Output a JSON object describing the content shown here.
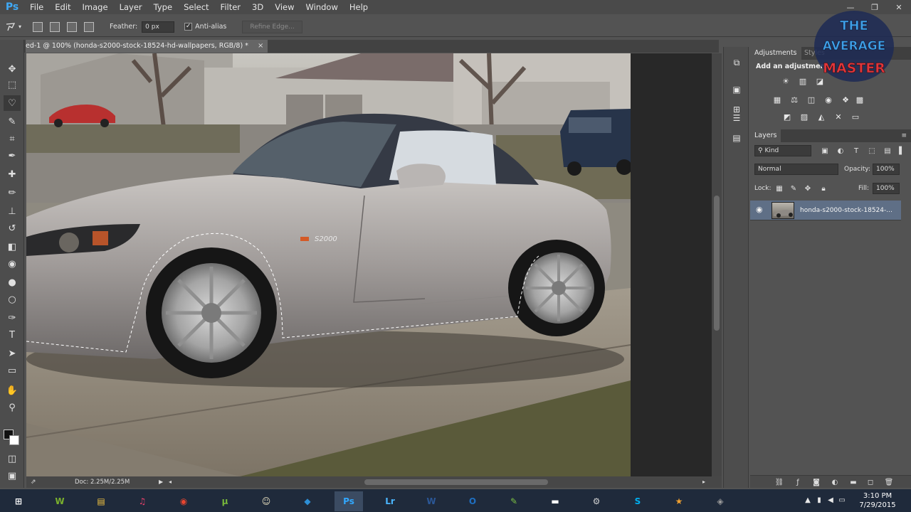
{
  "app": {
    "logo": "Ps"
  },
  "menubar": {
    "items": [
      "File",
      "Edit",
      "Image",
      "Layer",
      "Type",
      "Select",
      "Filter",
      "3D",
      "View",
      "Window",
      "Help"
    ]
  },
  "window_controls": {
    "minimize": "—",
    "restore": "❐",
    "close": "✕"
  },
  "options_bar": {
    "feather_label": "Feather:",
    "feather_value": "0 px",
    "antialias_checked": "✓",
    "antialias_label": "Anti-alias",
    "refine_edge_label": "Refine Edge..."
  },
  "document": {
    "tab_title": "ed-1 @ 100% (honda-s2000-stock-18524-hd-wallpapers, RGB/8) *",
    "tab_close": "×",
    "doc_size": "Doc: 2.25M/2.25M"
  },
  "tools": [
    {
      "name": "move-tool",
      "glyph": "✥"
    },
    {
      "name": "marquee-tool",
      "glyph": "⬚"
    },
    {
      "name": "lasso-tool",
      "glyph": "♡"
    },
    {
      "name": "quick-select-tool",
      "glyph": "✎"
    },
    {
      "name": "crop-tool",
      "glyph": "⌗"
    },
    {
      "name": "eyedropper-tool",
      "glyph": "✒"
    },
    {
      "name": "healing-brush-tool",
      "glyph": "✚"
    },
    {
      "name": "brush-tool",
      "glyph": "✏"
    },
    {
      "name": "clone-stamp-tool",
      "glyph": "⊥"
    },
    {
      "name": "history-brush-tool",
      "glyph": "↺"
    },
    {
      "name": "eraser-tool",
      "glyph": "◧"
    },
    {
      "name": "paint-bucket-tool",
      "glyph": "◉"
    },
    {
      "name": "blur-tool",
      "glyph": "●"
    },
    {
      "name": "dodge-tool",
      "glyph": "○"
    },
    {
      "name": "pen-tool",
      "glyph": "✑"
    },
    {
      "name": "type-tool",
      "glyph": "T"
    },
    {
      "name": "path-selection-tool",
      "glyph": "➤"
    },
    {
      "name": "rectangle-tool",
      "glyph": "▭"
    },
    {
      "name": "hand-tool",
      "glyph": "✋"
    },
    {
      "name": "zoom-tool",
      "glyph": "⚲"
    }
  ],
  "panels": {
    "adjustments_tab": "Adjustments",
    "styles_tab": "Styles",
    "adjustments_title": "Add an adjustment",
    "layers_tab": "Layers",
    "kind_filter": "Kind",
    "blend_mode": "Normal",
    "opacity_label": "Opacity:",
    "opacity_value": "100%",
    "lock_label": "Lock:",
    "fill_label": "Fill:",
    "fill_value": "100%",
    "layer_name": "honda-s2000-stock-18524-...",
    "layer_eye": "👁"
  },
  "canvas_image": {
    "badge_text": "S2000"
  },
  "watermark": {
    "line1": "THE",
    "line2": "AVERAGE",
    "line3": "MASTER"
  },
  "taskbar": {
    "apps": [
      {
        "name": "start",
        "label": "⊞"
      },
      {
        "name": "w-app",
        "label": "W"
      },
      {
        "name": "file-explorer",
        "label": "▤"
      },
      {
        "name": "itunes",
        "label": "♫"
      },
      {
        "name": "chrome",
        "label": "◉"
      },
      {
        "name": "utorrent",
        "label": "µ"
      },
      {
        "name": "app-cartoon",
        "label": "☺"
      },
      {
        "name": "app-kodi",
        "label": "◆"
      },
      {
        "name": "photoshop",
        "label": "Ps"
      },
      {
        "name": "lightroom",
        "label": "Lr"
      },
      {
        "name": "word",
        "label": "W"
      },
      {
        "name": "outlook",
        "label": "O"
      },
      {
        "name": "app-notes",
        "label": "✎"
      },
      {
        "name": "app-device",
        "label": "▬"
      },
      {
        "name": "steam",
        "label": "⚙"
      },
      {
        "name": "skype",
        "label": "S"
      },
      {
        "name": "app-game",
        "label": "★"
      },
      {
        "name": "app-slate",
        "label": "◈"
      }
    ],
    "time": "3:10 PM",
    "date": "7/29/2015"
  },
  "colors": {
    "ps_blue": "#3fa9f5",
    "ui_bg": "#535353",
    "selected_layer": "#5f6f86",
    "taskbar": "#1f2a3b"
  }
}
